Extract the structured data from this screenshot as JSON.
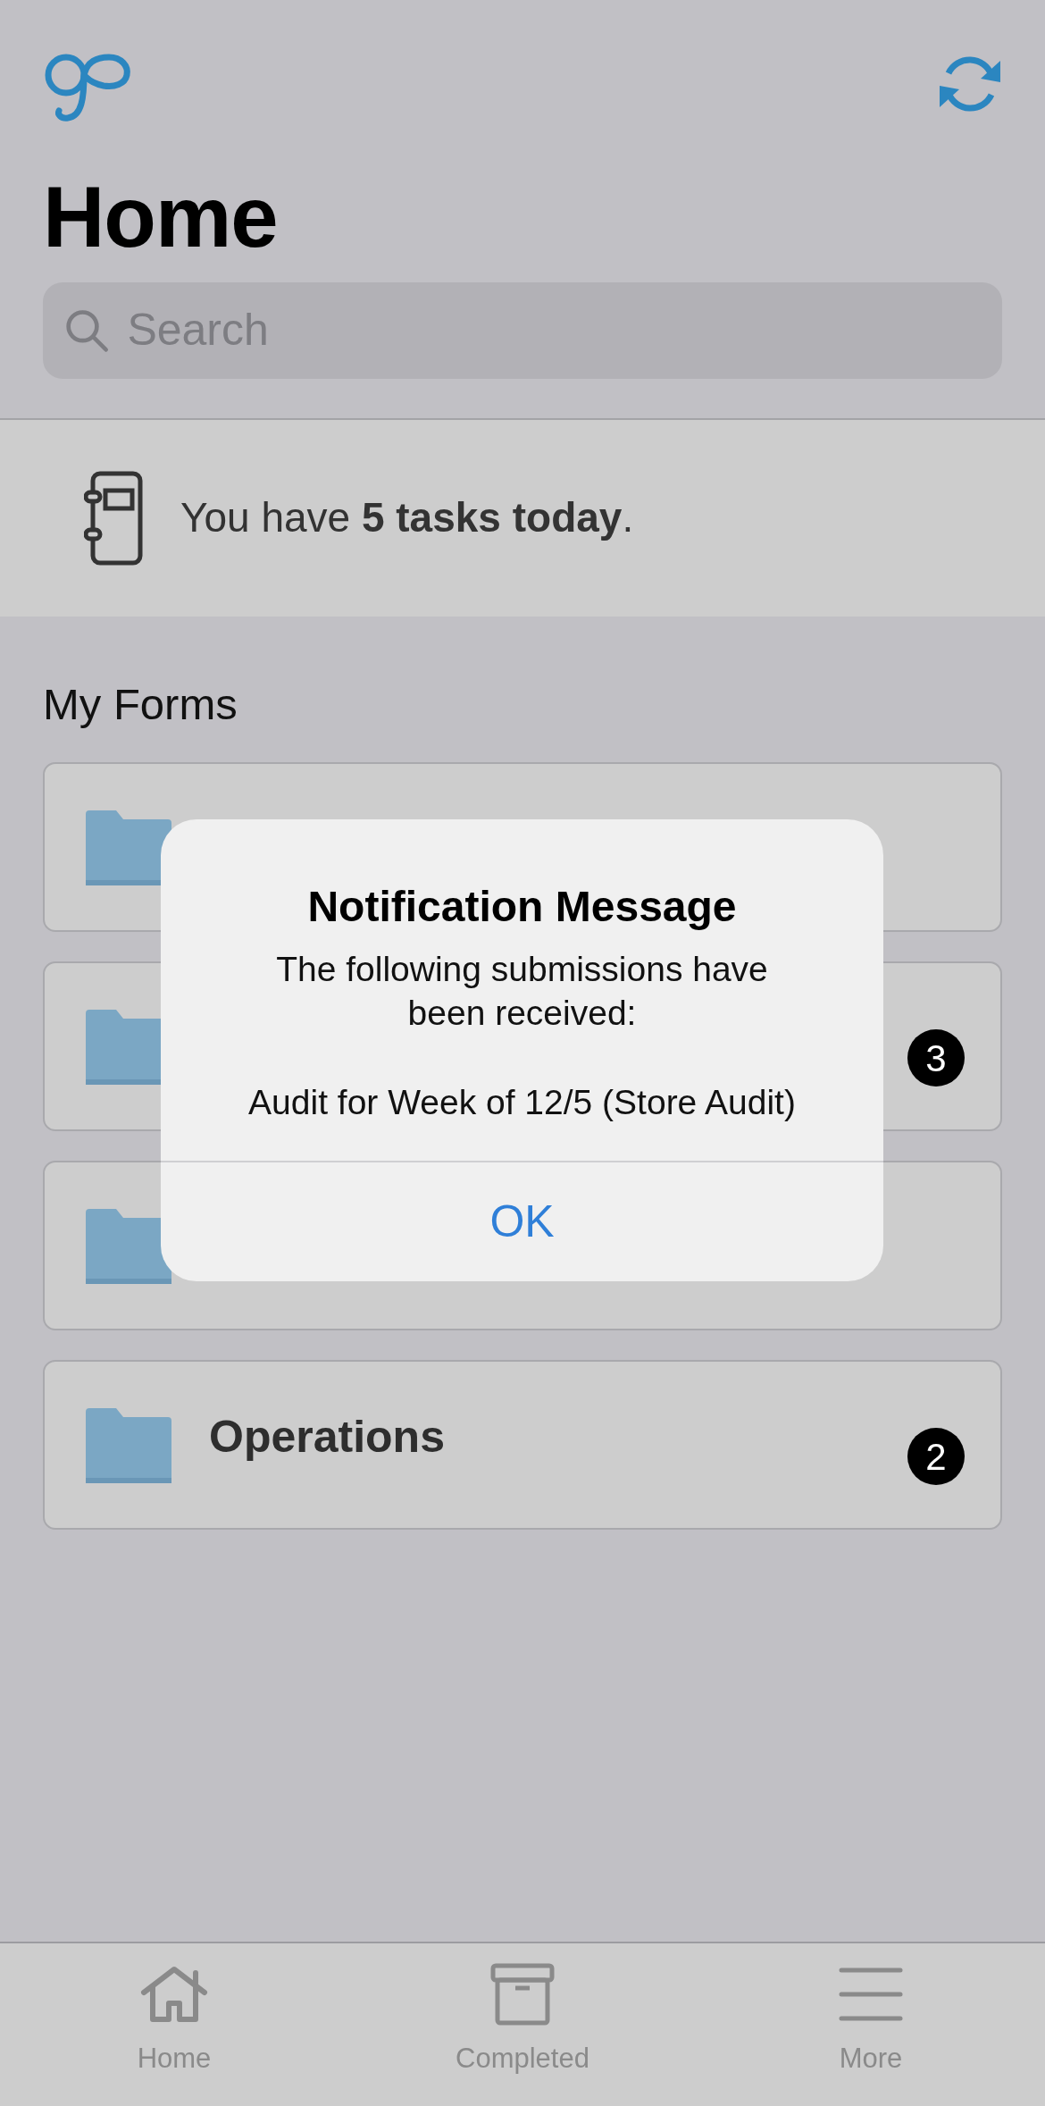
{
  "header": {
    "title": "Home"
  },
  "search": {
    "placeholder": "Search"
  },
  "banner": {
    "text": "You have **5 tasks today**."
  },
  "section_title": "My Forms",
  "forms": [
    {
      "kind": "folder"
    },
    {
      "kind": "folder",
      "badge": "3"
    },
    {
      "kind": "folder"
    },
    {
      "kind": "folder",
      "name": "Operations",
      "badge": "2"
    }
  ],
  "dialog": {
    "title": "Notification Message",
    "message": "The following submissions have been received:",
    "detail": "Audit for Week of 12/5 (Store Audit)",
    "buttons": [
      "OK"
    ]
  },
  "tabs": [
    {
      "kind": "home",
      "label": "Home",
      "selected": false
    },
    {
      "kind": "archive",
      "label": "Completed",
      "selected": false
    },
    {
      "kind": "menu",
      "label": "More",
      "selected": false
    }
  ]
}
